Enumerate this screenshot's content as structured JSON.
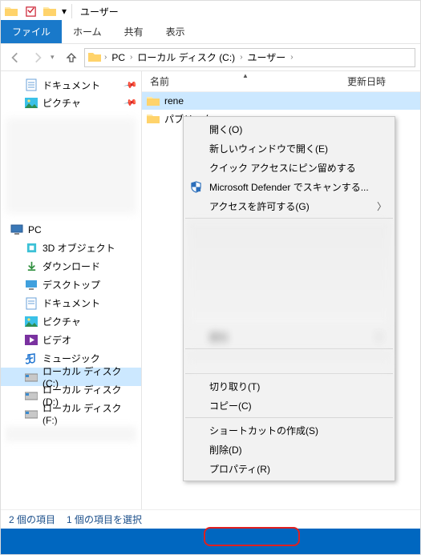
{
  "title": "ユーザー",
  "tabs": {
    "file": "ファイル",
    "home": "ホーム",
    "share": "共有",
    "view": "表示"
  },
  "breadcrumb": [
    "PC",
    "ローカル ディスク (C:)",
    "ユーザー"
  ],
  "quick_access": [
    {
      "label": "ドキュメント"
    },
    {
      "label": "ピクチャ"
    }
  ],
  "tree": {
    "root": "PC",
    "children": [
      "3D オブジェクト",
      "ダウンロード",
      "デスクトップ",
      "ドキュメント",
      "ピクチャ",
      "ビデオ",
      "ミュージック",
      "ローカル ディスク (C:)",
      "ローカル ディスク (D:)",
      "ローカル ディスク (F:)"
    ],
    "selected_index": 7
  },
  "columns": {
    "name": "名前",
    "date": "更新日時"
  },
  "files": [
    {
      "name": "rene",
      "selected": true
    },
    {
      "name": "パブリック",
      "selected": false
    }
  ],
  "status": {
    "count": "2 個の項目",
    "selection": "1 個の項目を選択"
  },
  "context_menu": {
    "open": "開く(O)",
    "open_new": "新しいウィンドウで開く(E)",
    "pin_qa": "クイック アクセスにピン留めする",
    "defender": "Microsoft Defender でスキャンする...",
    "grant_access": "アクセスを許可する(G)",
    "cut": "切り取り(T)",
    "copy": "コピー(C)",
    "shortcut": "ショートカットの作成(S)",
    "delete": "削除(D)",
    "properties": "プロパティ(R)"
  }
}
